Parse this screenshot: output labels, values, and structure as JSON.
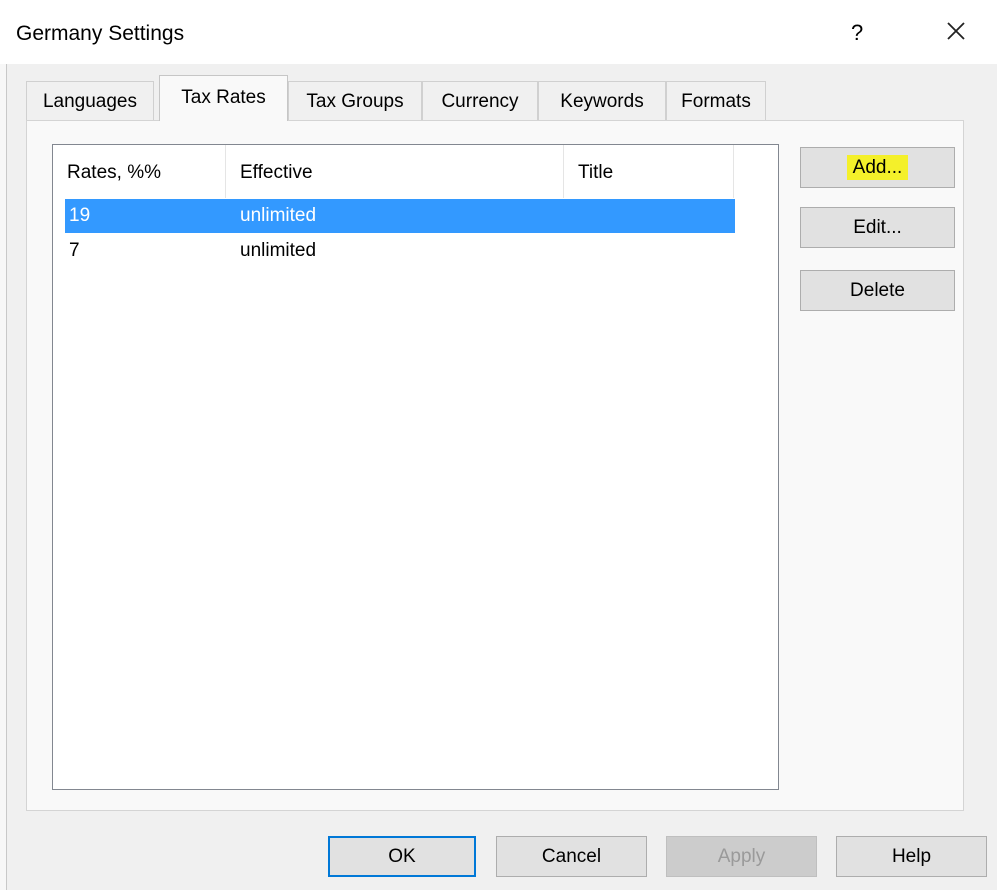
{
  "window": {
    "title": "Germany Settings",
    "help_glyph": "?",
    "close_icon": "close-icon"
  },
  "tabs": [
    {
      "label": "Languages",
      "active": false
    },
    {
      "label": "Tax Rates",
      "active": true
    },
    {
      "label": "Tax Groups",
      "active": false
    },
    {
      "label": "Currency",
      "active": false
    },
    {
      "label": "Keywords",
      "active": false
    },
    {
      "label": "Formats",
      "active": false
    }
  ],
  "list": {
    "columns": [
      "Rates, %%",
      "Effective",
      "Title"
    ],
    "rows": [
      {
        "rate": "19",
        "effective": "unlimited",
        "title": "",
        "selected": true
      },
      {
        "rate": "7",
        "effective": "unlimited",
        "title": "",
        "selected": false
      }
    ]
  },
  "side_buttons": {
    "add": "Add...",
    "edit": "Edit...",
    "delete": "Delete"
  },
  "footer_buttons": {
    "ok": "OK",
    "cancel": "Cancel",
    "apply": "Apply",
    "help": "Help"
  },
  "colors": {
    "selection": "#3399ff",
    "highlight": "#f4f02a",
    "default_border": "#0078d7"
  }
}
